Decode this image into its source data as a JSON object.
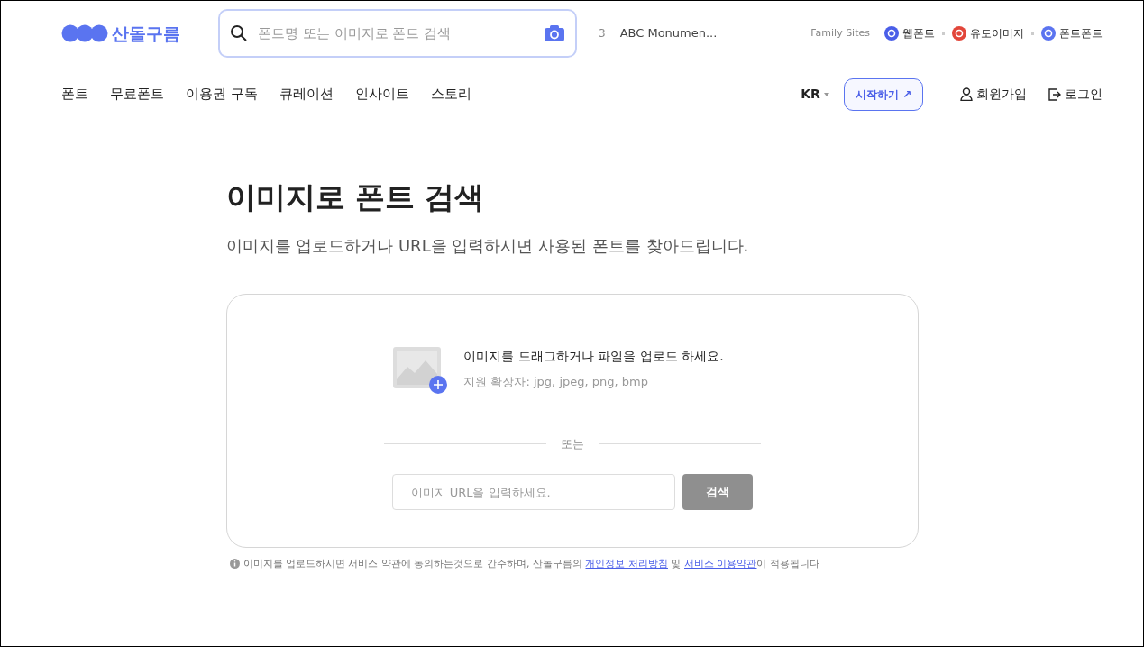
{
  "logo": {
    "text": "산돌구름"
  },
  "search": {
    "placeholder": "폰트명 또는 이미지로 폰트 검색"
  },
  "trending": {
    "rank": "3",
    "text": "ABC Monumen..."
  },
  "family_sites": {
    "label": "Family Sites",
    "items": [
      {
        "label": "웹폰트",
        "color": "#4a5ee8"
      },
      {
        "label": "유토이미지",
        "color": "#e2463a"
      },
      {
        "label": "폰트폰트",
        "color": "#5b74f0"
      }
    ]
  },
  "nav": [
    "폰트",
    "무료폰트",
    "이용권 구독",
    "큐레이션",
    "인사이트",
    "스토리"
  ],
  "language": "KR",
  "start_button": "시작하기 ↗",
  "account": [
    {
      "kind": "signup",
      "label": "회원가입"
    },
    {
      "kind": "login",
      "label": "로그인"
    }
  ],
  "page": {
    "title": "이미지로 폰트 검색",
    "subtitle": "이미지를 업로드하거나 URL을 입력하시면 사용된 폰트를 찾아드립니다."
  },
  "upload": {
    "prompt": "이미지를 드래그하거나 파일을 업로드 하세요.",
    "extensions": "지원 확장자: jpg, jpeg, png, bmp",
    "divider": "또는",
    "url_placeholder": "이미지 URL을 입력하세요.",
    "button": {
      "label": "검색",
      "disabled": true
    }
  },
  "notice": [
    {
      "kind": "text",
      "text": "이미지를 업로드하시면 서비스 약관에 동의하는것으로 간주하며, 산돌구름의 "
    },
    {
      "kind": "link",
      "text": "개인정보 처리방침"
    },
    {
      "kind": "text",
      "text": " 및 "
    },
    {
      "kind": "link",
      "text": "서비스 이용약관"
    },
    {
      "kind": "text",
      "text": "이 적용됩니다"
    }
  ]
}
